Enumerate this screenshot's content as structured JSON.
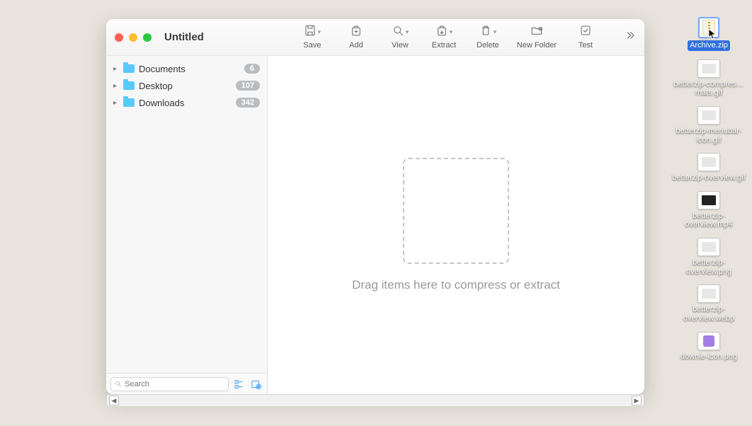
{
  "window": {
    "title": "Untitled"
  },
  "toolbar": {
    "save": "Save",
    "add": "Add",
    "view": "View",
    "extract": "Extract",
    "delete": "Delete",
    "new_folder": "New Folder",
    "test": "Test"
  },
  "sidebar": {
    "items": [
      {
        "name": "Documents",
        "count": "6"
      },
      {
        "name": "Desktop",
        "count": "107"
      },
      {
        "name": "Downloads",
        "count": "342"
      }
    ],
    "search_placeholder": "Search"
  },
  "main": {
    "drop_text": "Drag items here to compress or extract"
  },
  "desktop": {
    "items": [
      {
        "label": "Archive.zip",
        "kind": "zip",
        "selected": true
      },
      {
        "label": "betterzip-compres…mats.gif",
        "kind": "img"
      },
      {
        "label": "betterzip-menubar-icon.gif",
        "kind": "img"
      },
      {
        "label": "betterzip-overview.gif",
        "kind": "img"
      },
      {
        "label": "betterzip-overview.mp4",
        "kind": "vid"
      },
      {
        "label": "betterzip-overview.png",
        "kind": "img"
      },
      {
        "label": "betterzip-overview.webp",
        "kind": "img"
      },
      {
        "label": "downie-icon.png",
        "kind": "purple"
      }
    ]
  }
}
